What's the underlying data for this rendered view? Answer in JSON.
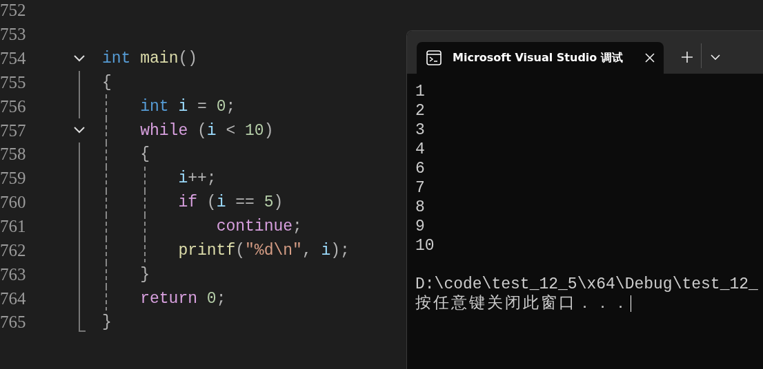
{
  "editor": {
    "lines": [
      {
        "number": "752",
        "fold": false
      },
      {
        "number": "753",
        "fold": false
      },
      {
        "number": "754",
        "fold": true,
        "tokens": [
          {
            "kind": "keyword",
            "text": "int"
          },
          {
            "kind": "func",
            "text": " main"
          },
          {
            "kind": "punct",
            "text": "()"
          }
        ]
      },
      {
        "number": "755",
        "fold": false,
        "tokens": [
          {
            "kind": "punct",
            "text": "{"
          }
        ]
      },
      {
        "number": "756",
        "fold": false,
        "tokens": [
          {
            "kind": "keyword",
            "text": "    int"
          },
          {
            "kind": "var",
            "text": " i"
          },
          {
            "kind": "punct",
            "text": " = "
          },
          {
            "kind": "number",
            "text": "0"
          },
          {
            "kind": "punct",
            "text": ";"
          }
        ]
      },
      {
        "number": "757",
        "fold": true,
        "tokens": [
          {
            "kind": "control",
            "text": "    while"
          },
          {
            "kind": "punct",
            "text": " ("
          },
          {
            "kind": "var",
            "text": "i"
          },
          {
            "kind": "punct",
            "text": " < "
          },
          {
            "kind": "number",
            "text": "10"
          },
          {
            "kind": "punct",
            "text": ")"
          }
        ]
      },
      {
        "number": "758",
        "fold": false,
        "tokens": [
          {
            "kind": "punct",
            "text": "    {"
          }
        ]
      },
      {
        "number": "759",
        "fold": false,
        "tokens": [
          {
            "kind": "var",
            "text": "        i"
          },
          {
            "kind": "punct",
            "text": "++;"
          }
        ]
      },
      {
        "number": "760",
        "fold": false,
        "tokens": [
          {
            "kind": "control",
            "text": "        if"
          },
          {
            "kind": "punct",
            "text": " ("
          },
          {
            "kind": "var",
            "text": "i"
          },
          {
            "kind": "punct",
            "text": " == "
          },
          {
            "kind": "number",
            "text": "5"
          },
          {
            "kind": "punct",
            "text": ")"
          }
        ]
      },
      {
        "number": "761",
        "fold": false,
        "tokens": [
          {
            "kind": "control",
            "text": "            continue"
          },
          {
            "kind": "punct",
            "text": ";"
          }
        ]
      },
      {
        "number": "762",
        "fold": false,
        "tokens": [
          {
            "kind": "func",
            "text": "        printf"
          },
          {
            "kind": "punct",
            "text": "("
          },
          {
            "kind": "string",
            "text": "\"%d\\n\""
          },
          {
            "kind": "punct",
            "text": ", "
          },
          {
            "kind": "var",
            "text": "i"
          },
          {
            "kind": "punct",
            "text": ");"
          }
        ]
      },
      {
        "number": "763",
        "fold": false,
        "tokens": [
          {
            "kind": "punct",
            "text": "    }"
          }
        ]
      },
      {
        "number": "764",
        "fold": false,
        "tokens": [
          {
            "kind": "control",
            "text": "    return"
          },
          {
            "kind": "number",
            "text": " 0"
          },
          {
            "kind": "punct",
            "text": ";"
          }
        ]
      },
      {
        "number": "765",
        "fold": false,
        "tokens": [
          {
            "kind": "punct",
            "text": "}"
          }
        ]
      }
    ]
  },
  "terminal": {
    "tab": {
      "title": "Microsoft Visual Studio 调试",
      "selected": true
    },
    "output": [
      "1",
      "2",
      "3",
      "4",
      "6",
      "7",
      "8",
      "9",
      "10"
    ],
    "messages": [
      "D:\\code\\test_12_5\\x64\\Debug\\test_12_",
      "按任意键关闭此窗口．．．"
    ]
  }
}
